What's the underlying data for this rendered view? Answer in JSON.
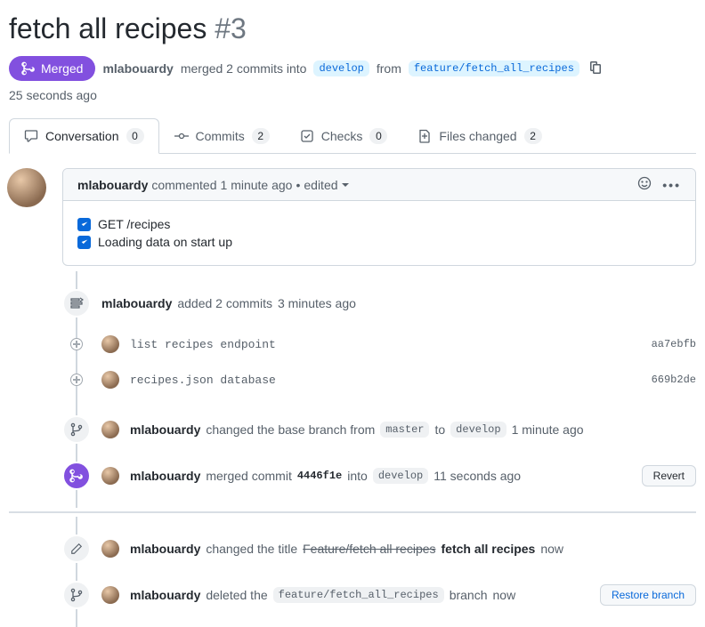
{
  "pr": {
    "title": "fetch all recipes",
    "number": "#3",
    "state": "Merged",
    "author": "mlabouardy",
    "merge_summary_1": "merged 2 commits into",
    "base_branch": "develop",
    "merge_summary_2": "from",
    "head_branch": "feature/fetch_all_recipes",
    "age": "25 seconds ago"
  },
  "tabs": {
    "conversation": {
      "label": "Conversation",
      "count": "0"
    },
    "commits": {
      "label": "Commits",
      "count": "2"
    },
    "checks": {
      "label": "Checks",
      "count": "0"
    },
    "files": {
      "label": "Files changed",
      "count": "2"
    }
  },
  "comment": {
    "author": "mlabouardy",
    "verb": "commented",
    "time": "1 minute ago",
    "edited": "edited",
    "tasks": [
      {
        "text": "GET /recipes",
        "checked": true
      },
      {
        "text": "Loading data on start up",
        "checked": true
      }
    ]
  },
  "events": {
    "added_commits": {
      "author": "mlabouardy",
      "text": "added 2 commits",
      "time": "3 minutes ago"
    },
    "commits": [
      {
        "msg": "list recipes endpoint",
        "sha": "aa7ebfb"
      },
      {
        "msg": "recipes.json database",
        "sha": "669b2de"
      }
    ],
    "base_change": {
      "author": "mlabouardy",
      "text1": "changed the base branch from",
      "from": "master",
      "text2": "to",
      "to": "develop",
      "time": "1 minute ago"
    },
    "merge": {
      "author": "mlabouardy",
      "text1": "merged commit",
      "sha": "4446f1e",
      "text2": "into",
      "branch": "develop",
      "time": "11 seconds ago",
      "revert": "Revert"
    },
    "rename": {
      "author": "mlabouardy",
      "text1": "changed the title",
      "old": "Feature/fetch all recipes",
      "new": "fetch all recipes",
      "time": "now"
    },
    "delete": {
      "author": "mlabouardy",
      "text1": "deleted the",
      "branch": "feature/fetch_all_recipes",
      "text2": "branch",
      "time": "now",
      "restore": "Restore branch"
    }
  }
}
